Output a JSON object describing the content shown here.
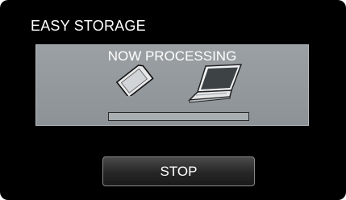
{
  "screen": {
    "title": "EASY STORAGE",
    "status_text": "NOW PROCESSING",
    "progress": 0.0,
    "icons": [
      "memory-card-icon",
      "laptop-icon"
    ],
    "stop_label": "STOP"
  },
  "colors": {
    "background": "#000000",
    "panel": "#8f9599",
    "text": "#ffffff"
  }
}
